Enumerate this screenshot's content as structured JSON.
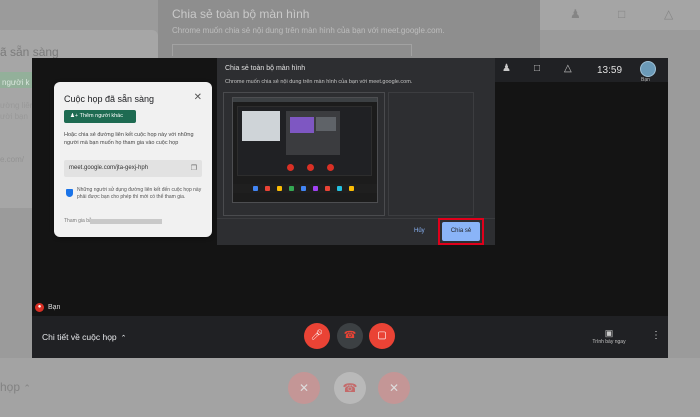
{
  "background": {
    "dialog_title": "Chia sẻ toàn bộ màn hình",
    "dialog_subtitle": "Chrome muốn chia sẻ nội dung trên màn hình của bạn với meet.google.com.",
    "card_title": "ã sẵn sàng",
    "card_chip": "người k",
    "card_text": "ường liên\nười bạn",
    "card_url": "e.com/",
    "bottom_label": "họp",
    "topbar_icons": [
      "people-icon",
      "chat-icon",
      "activities-icon"
    ]
  },
  "topbar": {
    "time": "13:59",
    "avatar_label": "Bạn",
    "icons": [
      "people-icon",
      "chat-icon",
      "activities-icon"
    ]
  },
  "ready_card": {
    "title": "Cuộc họp đã sẵn sàng",
    "add_button": "Thêm người khác",
    "description": "Hoặc chia sẻ đường liên kết cuộc họp này với những người mà bạn muốn họ tham gia vào cuộc họp",
    "url": "meet.google.com/jta-gexj-hph",
    "info": "Những người sử dụng đường liên kết đến cuộc họp này phải được bạn cho phép thì mới có thể tham gia.",
    "joined_label": "Tham gia bằng"
  },
  "share_dialog": {
    "title": "Chia sẻ toàn bộ màn hình",
    "subtitle": "Chrome muốn chia sẻ nội dung trên màn hình của bạn với meet.google.com.",
    "cancel": "Hủy",
    "share": "Chia sẻ"
  },
  "self_tile": {
    "name": "Bạn"
  },
  "bottombar": {
    "details_label": "Chi tiết về cuộc họp",
    "present_label": "Trình bày ngay"
  },
  "colors": {
    "accent_blue": "#8ab4f8",
    "end_call_red": "#ea4335",
    "highlight_red": "#e0001b",
    "add_button_green": "#1e6b52"
  }
}
